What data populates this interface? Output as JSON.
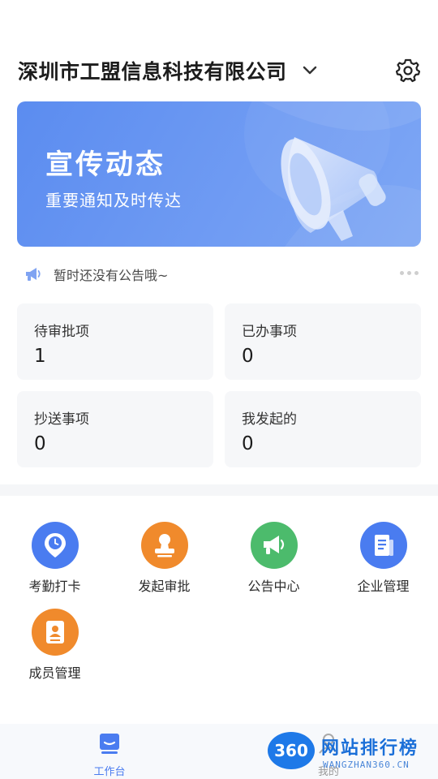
{
  "header": {
    "company_name": "深圳市工盟信息科技有限公司",
    "dropdown_icon": "chevron-down-icon",
    "settings_icon": "gear-icon"
  },
  "banner": {
    "title": "宣传动态",
    "subtitle": "重要通知及时传达",
    "icon": "megaphone-icon",
    "color": "#5b8cf0"
  },
  "notice": {
    "icon": "announcement-icon",
    "text": "暂时还没有公告哦~",
    "more_icon": "more-dots-icon"
  },
  "stats": [
    {
      "label": "待审批项",
      "value": "1"
    },
    {
      "label": "已办事项",
      "value": "0"
    },
    {
      "label": "抄送事项",
      "value": "0"
    },
    {
      "label": "我发起的",
      "value": "0"
    }
  ],
  "apps": [
    {
      "label": "考勤打卡",
      "icon": "location-clock-icon",
      "color": "#4a7cf0"
    },
    {
      "label": "发起审批",
      "icon": "stamp-icon",
      "color": "#f08a2c"
    },
    {
      "label": "公告中心",
      "icon": "megaphone-icon",
      "color": "#4cbb6c"
    },
    {
      "label": "企业管理",
      "icon": "document-icon",
      "color": "#4a7cf0"
    },
    {
      "label": "成员管理",
      "icon": "id-card-icon",
      "color": "#f08a2c"
    }
  ],
  "tabbar": {
    "items": [
      {
        "label": "工作台",
        "icon": "workbench-icon",
        "active": true,
        "color": "#4a7cf0"
      },
      {
        "label": "我的",
        "icon": "user-icon",
        "active": false,
        "color": "#999999"
      }
    ]
  },
  "watermark": {
    "badge": "360",
    "title": "网站排行榜",
    "subtitle": "WANGZHAN360.CN"
  }
}
